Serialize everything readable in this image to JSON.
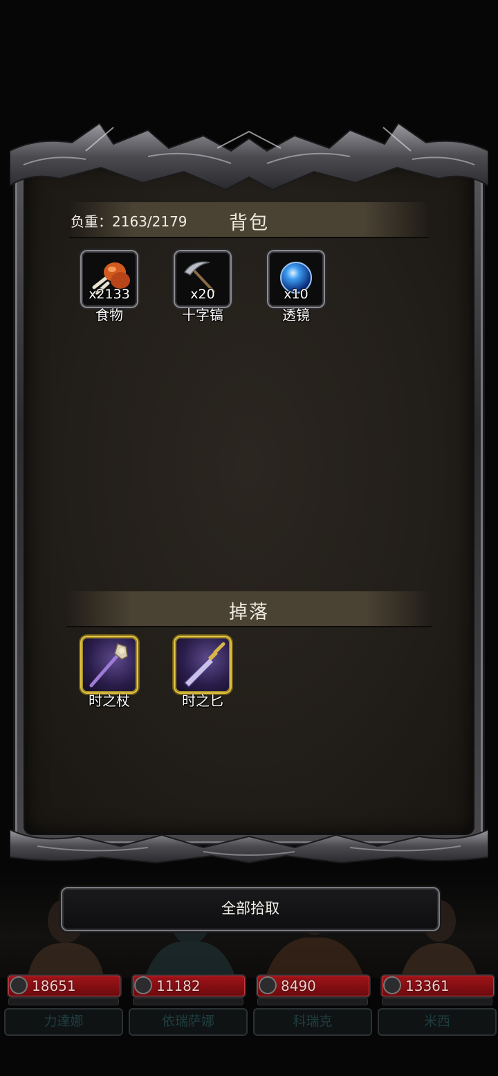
{
  "bag": {
    "title": "背包",
    "weight_label": "负重：2163/2179",
    "items": [
      {
        "name": "食物",
        "count": "x2133",
        "icon": "drumstick-icon"
      },
      {
        "name": "十字镐",
        "count": "x20",
        "icon": "pickaxe-icon"
      },
      {
        "name": "透镜",
        "count": "x10",
        "icon": "lens-orb-icon"
      }
    ]
  },
  "drops": {
    "title": "掉落",
    "items": [
      {
        "name": "时之杖",
        "icon": "staff-icon",
        "rarity_color": "#e3c544"
      },
      {
        "name": "时之匕",
        "icon": "dagger-icon",
        "rarity_color": "#e3c544"
      }
    ]
  },
  "actions": {
    "pickup_all": "全部拾取"
  },
  "party": [
    {
      "hp": "18651",
      "name": "力達娜"
    },
    {
      "hp": "11182",
      "name": "依瑞萨娜"
    },
    {
      "hp": "8490",
      "name": "科瑞克"
    },
    {
      "hp": "13361",
      "name": "米西"
    }
  ],
  "colors": {
    "panel_bg": "#221e19",
    "header_band": "#4a4233",
    "hp_red": "#a11318",
    "rare_gold": "#e3c544"
  }
}
